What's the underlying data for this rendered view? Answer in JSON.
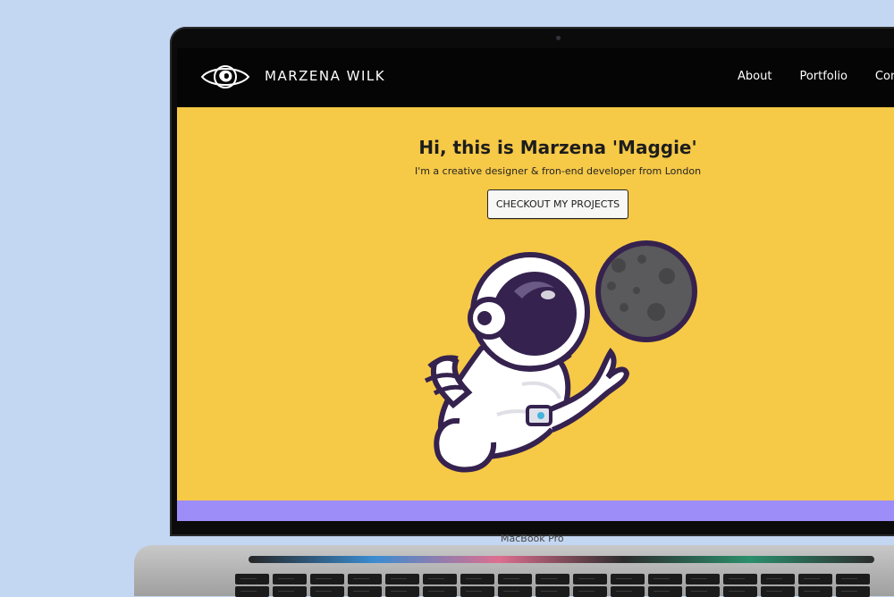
{
  "site": {
    "brand_name": "MARZENA WILK",
    "nav": [
      {
        "label": "About"
      },
      {
        "label": "Portfolio"
      },
      {
        "label": "Contact"
      }
    ]
  },
  "hero": {
    "title": "Hi, this is Marzena 'Maggie'",
    "subtitle": "I'm a creative designer & fron-end developer from London",
    "cta_label": "CHECKOUT MY PROJECTS"
  },
  "device": {
    "model_label": "MacBook Pro"
  },
  "colors": {
    "background": "#c3d6f2",
    "hero": "#f6c947",
    "nav": "#050505",
    "band": "#9d8df9",
    "illustration_purple": "#352356",
    "moon": "#555457"
  },
  "icons": {
    "logo": "eye-logo-icon",
    "astronaut": "astronaut-icon",
    "moon": "moon-icon"
  }
}
